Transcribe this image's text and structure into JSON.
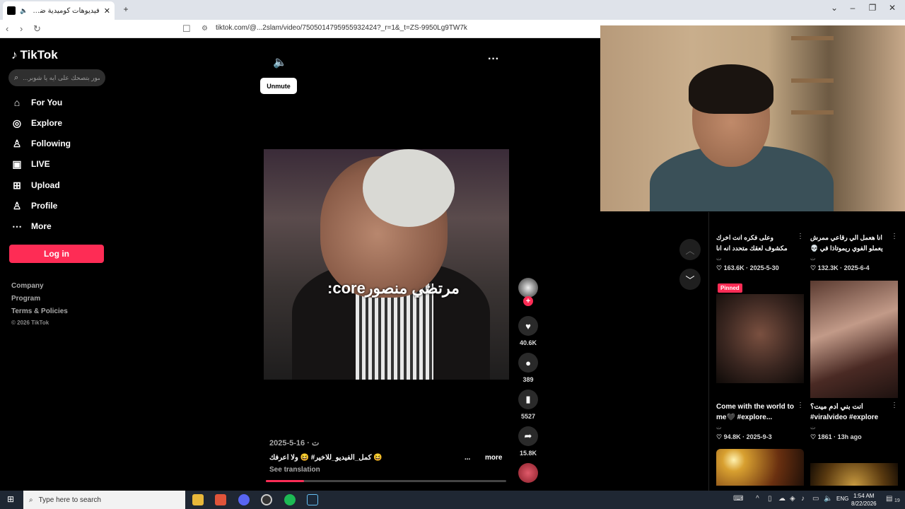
{
  "browser": {
    "tab_title": "فيديوهات كوميدية ضاحكة مع",
    "url": "tiktok.com/@...2slam/video/7505014795955932424?_r=1&_t=ZS-9950Lg9TW7k",
    "new_tab": "+"
  },
  "sidebar": {
    "logo": "TikTok",
    "search_placeholder": "...صور بتصحك على ايه يا شوبر",
    "items": [
      {
        "label": "For You",
        "icon": "home-icon"
      },
      {
        "label": "Explore",
        "icon": "compass-icon"
      },
      {
        "label": "Following",
        "icon": "following-icon"
      },
      {
        "label": "LIVE",
        "icon": "live-icon"
      },
      {
        "label": "Upload",
        "icon": "upload-icon"
      },
      {
        "label": "Profile",
        "icon": "profile-icon"
      },
      {
        "label": "More",
        "icon": "more-icon"
      }
    ],
    "login": "Log in",
    "footer": [
      "Company",
      "Program",
      "Terms & Policies",
      "© 2026 TikTok"
    ]
  },
  "video": {
    "tooltip": "Unmute",
    "caption": "مرتضي منصورcore:",
    "date": "2025-5-16 · ت",
    "description": "😆 كمل_الفيديو_للاخير# 😆 ولا اعرفك",
    "ellipsis": "...",
    "more": "more",
    "see_translation": "See translation",
    "progress_fraction": 0.16,
    "likes": "40.6K",
    "comments": "389",
    "saves": "5527",
    "shares": "15.8K"
  },
  "grid": [
    {
      "title": "وعلى فكره انت اخرك مكشوف لعقك متحدد انه انا ماليش اخر ق...",
      "sub": "ت",
      "stat": "163.6K · 2025-5-30"
    },
    {
      "title": "انا هعمل الي رقاعي ممرش يعملو الفوي ريموتاذا في 💀 ...",
      "sub": "ت",
      "stat": "132.3K · 2025-6-4"
    },
    {
      "title": "Come with the world to me🖤 #explore...",
      "sub": "ت",
      "stat": "94.8K · 2025-9-3",
      "pinned": "Pinned"
    },
    {
      "title": "انت بني ادم ميت؟ #viralvideo #explore #الاسطورة...",
      "sub": "ت",
      "stat": "1861 · 13h ago"
    }
  ],
  "taskbar": {
    "search_placeholder": "Type here to search",
    "lang": "ENG",
    "time": "1:54 AM",
    "date": "8/22/2026",
    "notif_count": "19"
  }
}
